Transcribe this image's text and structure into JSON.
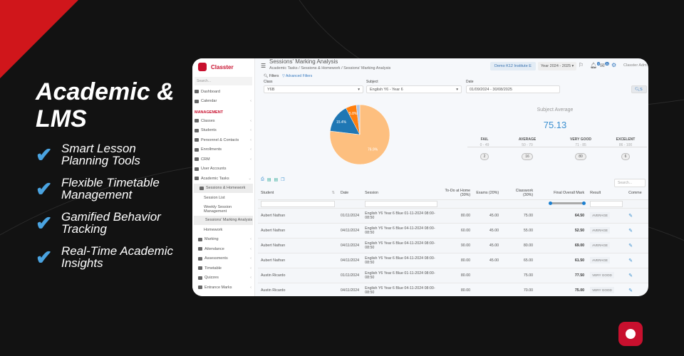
{
  "hero": {
    "title": "Academic & LMS",
    "features": [
      "Smart Lesson Planning Tools",
      "Flexible Timetable Management",
      "Gamified Behavior Tracking",
      "Real-Time Academic Insights"
    ]
  },
  "app": {
    "name": "Classter",
    "search_placeholder": "Search...",
    "sidebar": {
      "dashboard": "Dashboard",
      "calendar": "Calendar",
      "section": "MANAGEMENT",
      "classes": "Classes",
      "students": "Students",
      "personnel": "Personnel & Contacts",
      "enrollments": "Enrollments",
      "crm": "CRM",
      "user_accounts": "User Accounts",
      "academic_tasks": "Academic Tasks",
      "sessions_homework": "Sessions & Homework",
      "session_list": "Session List",
      "weekly": "Weekly Session Management",
      "marking_analysis": "Sessions' Marking Analysis",
      "homework": "Homework",
      "marking": "Marking",
      "attendance": "Attendance",
      "assessments": "Assessments",
      "timetable": "Timetable",
      "quizzes": "Quizzes",
      "entrance": "Entrance Marks"
    },
    "header": {
      "title": "Sessions' Marking Analysis",
      "breadcrumb": "Academic Tasks / Sessions & Homework / Sessions' Marking Analysis",
      "institute": "Demo K12 Institute E",
      "year": "Year 2024 - 2025 ▾",
      "notif_count": "0",
      "msg_count": "24",
      "user": "Classter Adm"
    },
    "filters": {
      "filters_label": "Filters",
      "advanced": "Advanced Filters",
      "class_label": "Class",
      "class_value": "Y6B",
      "subject_label": "Subject",
      "subject_value": "English Y6 - Year 6",
      "date_label": "Date",
      "date_value": "01/09/2024 - 30/08/2025",
      "search_btn": "S"
    },
    "average": {
      "heading": "Subject Average",
      "value": "75.13",
      "bands": [
        {
          "name": "FAIL",
          "range": "0 - 49",
          "count": "2"
        },
        {
          "name": "AVERAGE",
          "range": "50 - 70",
          "count": "16"
        },
        {
          "name": "VERY GOOD",
          "range": "71 - 85",
          "count": "80"
        },
        {
          "name": "EXCELENT",
          "range": "86 - 100",
          "count": "6"
        }
      ]
    },
    "table": {
      "search_placeholder": "Search...",
      "columns": [
        "Student",
        "Date",
        "Session",
        "To-Do at Home (30%)",
        "Exams (20%)",
        "Classwork (30%)",
        "Final Overall Mark",
        "Result",
        "Comme"
      ],
      "rows": [
        [
          "Aubert Nathan",
          "01/11/2024",
          "English Y6 Year 6 Blue 01-11-2024 08:00-08:50",
          "80.00",
          "45.00",
          "75.00",
          "64.50",
          "AVERAGE"
        ],
        [
          "Aubert Nathan",
          "04/11/2024",
          "English Y6 Year 6 Blue 04-11-2024 08:00-08:50",
          "60.00",
          "45.00",
          "55.00",
          "52.50",
          "AVERAGE"
        ],
        [
          "Aubert Nathan",
          "04/11/2024",
          "English Y6 Year 6 Blue 04-11-2024 08:00-08:50",
          "90.00",
          "45.00",
          "80.00",
          "69.00",
          "AVERAGE"
        ],
        [
          "Aubert Nathan",
          "04/11/2024",
          "English Y6 Year 6 Blue 04-11-2024 08:00-08:50",
          "80.00",
          "45.00",
          "65.00",
          "61.50",
          "AVERAGE"
        ],
        [
          "Austin Ricardo",
          "01/11/2024",
          "English Y6 Year 6 Blue 01-11-2024 08:00-08:50",
          "80.00",
          "",
          "75.00",
          "77.50",
          "VERY GOOD"
        ],
        [
          "Austin Ricardo",
          "04/11/2024",
          "English Y6 Year 6 Blue 04-11-2024 08:00-08:50",
          "80.00",
          "",
          "70.00",
          "75.00",
          "VERY GOOD"
        ]
      ]
    }
  },
  "chart_data": {
    "type": "pie",
    "values": [
      76.9,
      15.4,
      5.8,
      1.9
    ],
    "labels": [
      "76.9%",
      "15.4%",
      "5.8%",
      ""
    ],
    "colors": [
      "#fdbf7f",
      "#1f77b4",
      "#ff7f0e",
      "#aec7e8"
    ]
  }
}
